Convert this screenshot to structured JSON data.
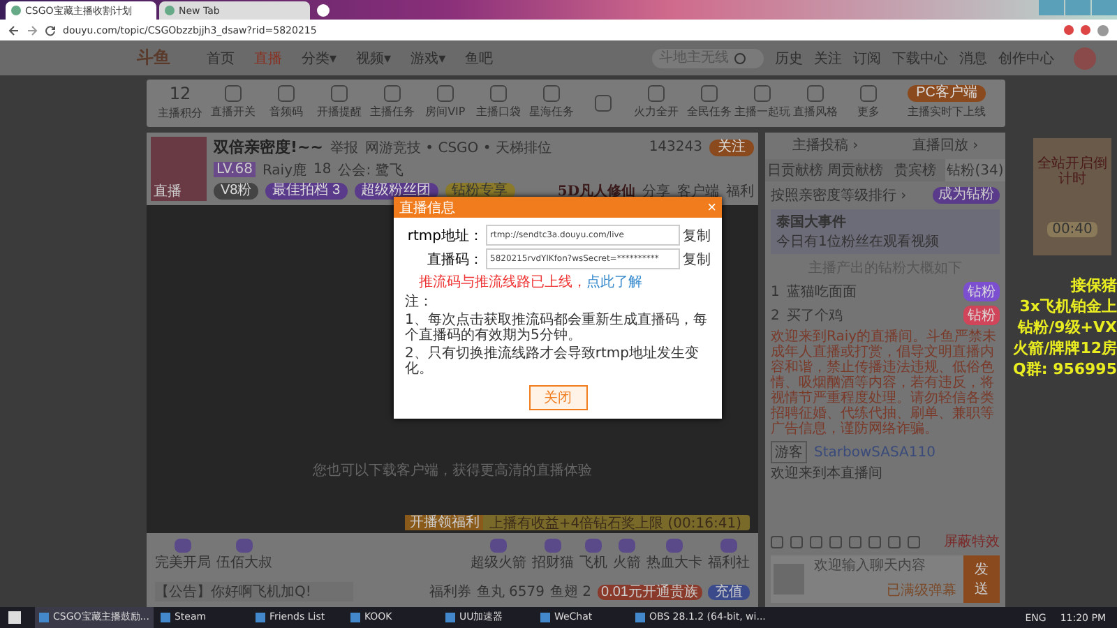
{
  "browser": {
    "tabs": [
      {
        "title": "CSGO宝藏主播收割计划",
        "selected": true
      },
      {
        "title": "New Tab",
        "selected": false
      }
    ],
    "url": "douyu.com/topic/CSGObzzbjjh3_dsaw?rid=5820215"
  },
  "site_header": {
    "logo": "斗鱼",
    "nav": [
      {
        "label": "首页",
        "selected": false
      },
      {
        "label": "直播",
        "selected": true
      },
      {
        "label": "分类▾",
        "selected": false
      },
      {
        "label": "视频▾",
        "selected": false
      },
      {
        "label": "游戏▾",
        "selected": false
      },
      {
        "label": "鱼吧",
        "selected": false
      }
    ],
    "search_placeholder": "斗地主无线",
    "actions": [
      "历史",
      "关注",
      "订阅",
      "下载中心",
      "消息",
      "创作中心"
    ]
  },
  "toolbar": {
    "points": "12",
    "points_label": "主播积分",
    "items": [
      "直播开关",
      "音频码",
      "开播提醒",
      "主播任务",
      "房间VIP",
      "主播口袋",
      "星海任务"
    ],
    "items_after_gift": [
      "火力全开",
      "全民任务",
      "主播一起玩",
      "直播风格",
      "更多"
    ],
    "client_button": "PC客户端",
    "client_note": "主播实时下上线"
  },
  "stream": {
    "avatar_caption": "直播",
    "title": "双倍亲密度!~~",
    "report": "举报",
    "category": "网游竞技 • CSGO • 天梯排位",
    "level": "LV.68",
    "streamer": "Raiy鹿",
    "heat": "18",
    "guild": "公会: 鹭飞",
    "tags": [
      "V8粉",
      "最佳拍档 3",
      "超级粉丝团",
      "钻粉专享"
    ],
    "followers": "143243",
    "follow": "关注",
    "ad": "5D凡人修仙",
    "links": [
      "分享",
      "客户端",
      "福利"
    ]
  },
  "video": {
    "notice": "您也可以下载客户端，获得更高清的直播体验"
  },
  "modal": {
    "title": "直播信息",
    "close": "×",
    "fields": [
      {
        "label": "rtmp地址：",
        "value": "rtmp://sendtc3a.douyu.com/live",
        "action": "复制"
      },
      {
        "label": "直播码：",
        "value": "5820215rvdYlKfon?wsSecret=**********",
        "action": "复制"
      }
    ],
    "warning": "推流码与推流线路已上线，",
    "link": "点此了解",
    "note_title": "注：",
    "notes": [
      "1、每次点击获取推流码都会重新生成直播码，每个直播码的有效期为5分钟。",
      "2、只有切换推流线路才会导致rtmp地址发生变化。"
    ],
    "close_button": "关闭"
  },
  "gift_bar": {
    "banner_tag": "开播领福利",
    "banner_text": "上播有收益+4倍钻石奖上限 (00:16:41)",
    "left_gifts": [
      "完美开局",
      "伍佰大叔"
    ],
    "right_gifts": [
      "超级火箭",
      "招财猫",
      "飞机",
      "火箭",
      "热血大卡",
      "福利社"
    ],
    "announcement": "【公告】你好啊飞机加Q!",
    "welfare": "福利券",
    "fish_ball": "鱼丸 6579",
    "fish_fin": "鱼翅 2",
    "noble": "0.01元开通贵族",
    "recharge": "充值"
  },
  "chat": {
    "links": [
      "主播投稿 ›",
      "直播回放 ›"
    ],
    "tabs": [
      {
        "label": "日贡献榜",
        "selected": false
      },
      {
        "label": "周贡献榜",
        "selected": false
      },
      {
        "label": "贵宾榜",
        "selected": false
      },
      {
        "label": "钻粉(34)",
        "selected": true
      }
    ],
    "rank_hint": "按照亲密度等级排行 ›",
    "join_button": "成为钻粉",
    "event_title": "泰国大事件",
    "event_text": "今日有1位粉丝在观看视频",
    "list_hint": "主播产出的钻粉大概如下",
    "ranks": [
      {
        "rank": "1",
        "name": "蓝猫吃面面",
        "badge": "钻粉",
        "color": "#7b4fd0"
      },
      {
        "rank": "2",
        "name": "买了个鸡",
        "badge": "钻粉",
        "color": "#d0455a"
      }
    ],
    "system_message": "欢迎来到Raiy的直播间。斗鱼严禁未成年人直播或打赏，倡导文明直播内容和谐，禁止传播违法违规、低俗色情、吸烟酗酒等内容，若有违反，将视情节严重程度处理。请勿轻信各类招聘征婚、代练代抽、刷单、兼职等广告信息，谨防网络诈骗。",
    "messages": [
      {
        "tag": "游客",
        "user": "StarbowSASA110",
        "text": "欢迎来到本直播间"
      }
    ],
    "shield": "屏蔽特效",
    "input_placeholder": "欢迎输入聊天内容",
    "input_hint": "已满级弹幕",
    "send": "发送"
  },
  "overlay": {
    "ad_title": "全站开启倒计时",
    "ad_timer": "00:40",
    "lines": [
      "接保猪",
      "3x飞机铂金上",
      "钻粉/9级+VX",
      "火箭/牌牌12房",
      "Q群: 956995"
    ]
  },
  "taskbar": {
    "apps": [
      {
        "label": "CSGO宝藏主播鼓励...",
        "selected": true
      },
      {
        "label": "Steam",
        "selected": false
      },
      {
        "label": "Friends List",
        "selected": false
      },
      {
        "label": "KOOK",
        "selected": false
      },
      {
        "label": "UU加速器",
        "selected": false
      },
      {
        "label": "WeChat",
        "selected": false
      },
      {
        "label": "OBS 28.1.2 (64-bit, wi...",
        "selected": false
      }
    ],
    "language": "ENG",
    "time": "11:20 PM"
  }
}
